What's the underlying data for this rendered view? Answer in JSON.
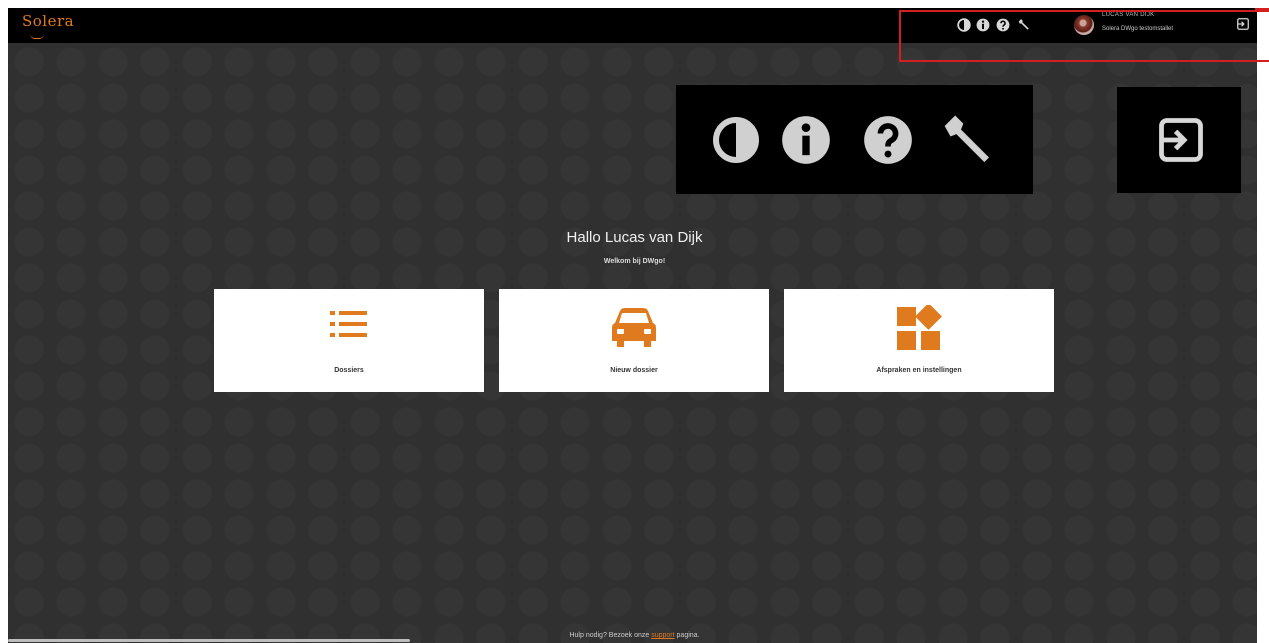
{
  "header": {
    "logo_text": "Solera",
    "user_name": "LUCAS VAN DIJK",
    "user_org": "Solera DWgo testomstallet",
    "icons": [
      "contrast-icon",
      "info-icon",
      "help-icon",
      "wrench-icon",
      "logout-icon"
    ]
  },
  "main": {
    "greeting": "Hallo Lucas van Dijk",
    "subgreeting": "Welkom bij DWgo!",
    "cards": [
      {
        "label": "Dossiers",
        "icon": "list-icon"
      },
      {
        "label": "Nieuw dossier",
        "icon": "car-icon"
      },
      {
        "label": "Afspraken en instellingen",
        "icon": "apps-icon"
      }
    ]
  },
  "footer": {
    "text_before": "Hulp nodig? Bezoek onze",
    "link_text": "support",
    "text_after": "pagina."
  },
  "colors": {
    "accent": "#e07a1f",
    "highlight": "#d21f1f",
    "background": "#303030",
    "topbar": "#000000"
  }
}
